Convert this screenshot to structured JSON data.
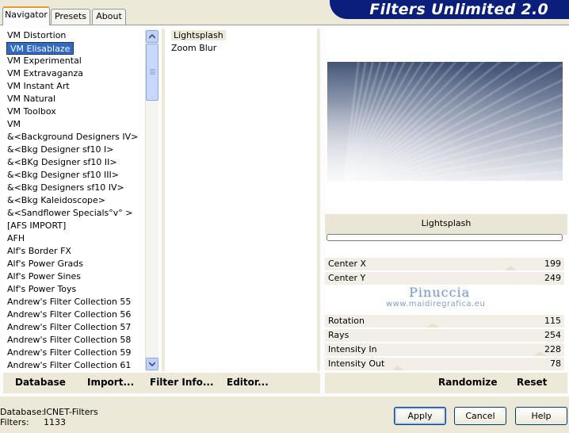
{
  "app": {
    "title": "Filters Unlimited 2.0"
  },
  "tabs": [
    {
      "label": "Navigator",
      "active": true
    },
    {
      "label": "Presets",
      "active": false
    },
    {
      "label": "About",
      "active": false
    }
  ],
  "categories": [
    "VM Distortion",
    "VM Elisablaze",
    "VM Experimental",
    "VM Extravaganza",
    "VM Instant Art",
    "VM Natural",
    "VM Toolbox",
    "VM",
    "&<Background Designers IV>",
    "&<Bkg Designer sf10 I>",
    "&<BKg Designer sf10 II>",
    "&<Bkg Designer sf10 III>",
    "&<Bkg Designers sf10 IV>",
    "&<Bkg Kaleidoscope>",
    "&<Sandflower Specials°v° >",
    "[AFS IMPORT]",
    "AFH",
    "Alf's Border FX",
    "Alf's Power Grads",
    "Alf's Power Sines",
    "Alf's Power Toys",
    "Andrew's Filter Collection 55",
    "Andrew's Filter Collection 56",
    "Andrew's Filter Collection 57",
    "Andrew's Filter Collection 58",
    "Andrew's Filter Collection 59",
    "Andrew's Filter Collection 61"
  ],
  "selected_category_index": 1,
  "filters": [
    {
      "label": "Lightsplash",
      "selected": true
    },
    {
      "label": "Zoom Blur",
      "selected": false
    }
  ],
  "preview": {
    "filter_name": "Lightsplash"
  },
  "parameters": [
    {
      "name": "Center X",
      "value": "199"
    },
    {
      "name": "Center Y",
      "value": "249"
    },
    {
      "name": "Rotation",
      "value": "115"
    },
    {
      "name": "Rays",
      "value": "254"
    },
    {
      "name": "Intensity In",
      "value": "228"
    },
    {
      "name": "Intensity Out",
      "value": "78"
    }
  ],
  "watermark": {
    "name": "Pinuccia",
    "url": "www.maidiregrafica.eu"
  },
  "toolbar": {
    "database": "Database",
    "import": "Import...",
    "filter_info": "Filter Info...",
    "editor": "Editor...",
    "randomize": "Randomize",
    "reset": "Reset"
  },
  "status": {
    "database_label": "Database:",
    "database_value": "ICNET-Filters",
    "filters_label": "Filters:",
    "filters_value": "1133"
  },
  "buttons": {
    "apply": "Apply",
    "cancel": "Cancel",
    "help": "Help"
  },
  "colors": {
    "banner": "#0b1f7a",
    "selection": "#316ac5",
    "window_bg": "#ece9d8"
  }
}
